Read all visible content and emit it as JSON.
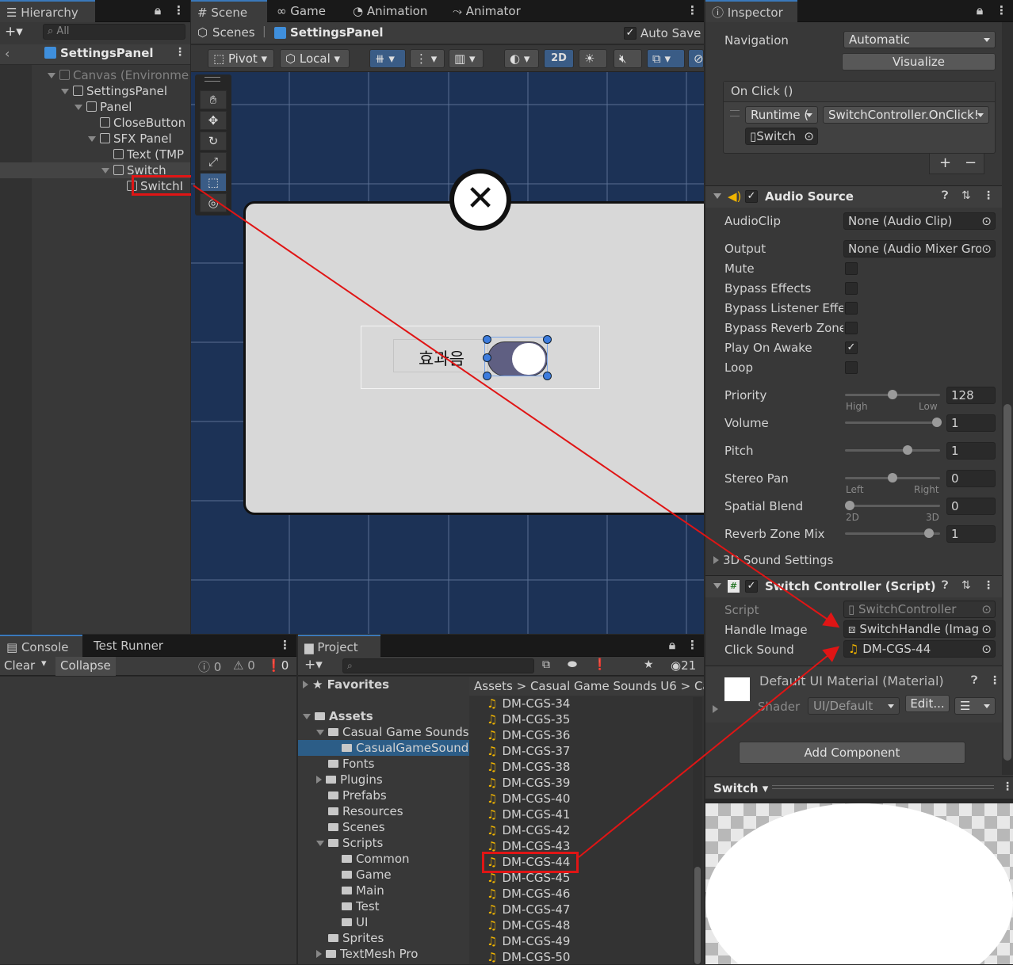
{
  "hierarchy": {
    "tab": "Hierarchy",
    "search_placeholder": "All",
    "breadcrumb": "SettingsPanel",
    "items": [
      {
        "label": "Canvas (Environme",
        "depth": 1,
        "dim": true
      },
      {
        "label": "SettingsPanel",
        "depth": 2
      },
      {
        "label": "Panel",
        "depth": 3
      },
      {
        "label": "CloseButton",
        "depth": 4
      },
      {
        "label": "SFX Panel",
        "depth": 4
      },
      {
        "label": "Text (TMP",
        "depth": 5
      },
      {
        "label": "Switch",
        "depth": 5
      },
      {
        "label": "SwitchI",
        "depth": 6
      }
    ]
  },
  "scene": {
    "tabs": [
      "Scene",
      "Game",
      "Animation",
      "Animator"
    ],
    "scenes_label": "Scenes",
    "prefab_name": "SettingsPanel",
    "auto_save": "Auto Save",
    "pivot": "Pivot",
    "local": "Local",
    "mode_2d": "2D",
    "switch_label_text": "효과음"
  },
  "console": {
    "tabs": [
      "Console",
      "Test Runner"
    ],
    "clear": "Clear",
    "collapse": "Collapse",
    "counts": [
      "0",
      "0",
      "0"
    ]
  },
  "project": {
    "tab": "Project",
    "count": "21",
    "favorites": "Favorites",
    "tree": [
      {
        "label": "Assets",
        "depth": 0,
        "bold": true
      },
      {
        "label": "Casual Game Sounds",
        "depth": 1
      },
      {
        "label": "CasualGameSound",
        "depth": 2,
        "selected": true
      },
      {
        "label": "Fonts",
        "depth": 1
      },
      {
        "label": "Plugins",
        "depth": 1
      },
      {
        "label": "Prefabs",
        "depth": 1
      },
      {
        "label": "Resources",
        "depth": 1
      },
      {
        "label": "Scenes",
        "depth": 1
      },
      {
        "label": "Scripts",
        "depth": 1
      },
      {
        "label": "Common",
        "depth": 2
      },
      {
        "label": "Game",
        "depth": 2
      },
      {
        "label": "Main",
        "depth": 2
      },
      {
        "label": "Test",
        "depth": 2
      },
      {
        "label": "UI",
        "depth": 2
      },
      {
        "label": "Sprites",
        "depth": 1
      },
      {
        "label": "TextMesh Pro",
        "depth": 1
      }
    ],
    "breadcrumb": [
      "Assets",
      "Casual Game Sounds U6",
      "Ca"
    ],
    "files": [
      "DM-CGS-34",
      "DM-CGS-35",
      "DM-CGS-36",
      "DM-CGS-37",
      "DM-CGS-38",
      "DM-CGS-39",
      "DM-CGS-40",
      "DM-CGS-41",
      "DM-CGS-42",
      "DM-CGS-43",
      "DM-CGS-44",
      "DM-CGS-45",
      "DM-CGS-46",
      "DM-CGS-47",
      "DM-CGS-48",
      "DM-CGS-49",
      "DM-CGS-50"
    ]
  },
  "inspector": {
    "tab": "Inspector",
    "navigation_label": "Navigation",
    "navigation_value": "Automatic",
    "visualize": "Visualize",
    "onclick_header": "On Click ()",
    "runtime": "Runtime (",
    "function": "SwitchController.OnClick!",
    "target": "Switch",
    "audio_source": {
      "title": "Audio Source",
      "audioclip_label": "AudioClip",
      "audioclip_value": "None (Audio Clip)",
      "output_label": "Output",
      "output_value": "None (Audio Mixer Gro",
      "mute": "Mute",
      "bypass_effects": "Bypass Effects",
      "bypass_listener": "Bypass Listener Effe",
      "bypass_reverb": "Bypass Reverb Zone",
      "play_on_awake": "Play On Awake",
      "loop": "Loop",
      "priority_label": "Priority",
      "priority_value": "128",
      "priority_high": "High",
      "priority_low": "Low",
      "volume_label": "Volume",
      "volume_value": "1",
      "pitch_label": "Pitch",
      "pitch_value": "1",
      "stereo_label": "Stereo Pan",
      "stereo_value": "0",
      "stereo_left": "Left",
      "stereo_right": "Right",
      "spatial_label": "Spatial Blend",
      "spatial_value": "0",
      "spatial_2d": "2D",
      "spatial_3d": "3D",
      "reverb_label": "Reverb Zone Mix",
      "reverb_value": "1",
      "sound3d": "3D Sound Settings"
    },
    "switch_controller": {
      "title": "Switch Controller (Script)",
      "script_label": "Script",
      "script_value": "SwitchController",
      "handle_label": "Handle Image",
      "handle_value": "SwitchHandle (Imag",
      "click_label": "Click Sound",
      "click_value": "DM-CGS-44"
    },
    "material": {
      "title": "Default UI Material (Material)",
      "shader_label": "Shader",
      "shader_value": "UI/Default",
      "edit": "Edit..."
    },
    "add_component": "Add Component",
    "preview_title": "Switch"
  }
}
